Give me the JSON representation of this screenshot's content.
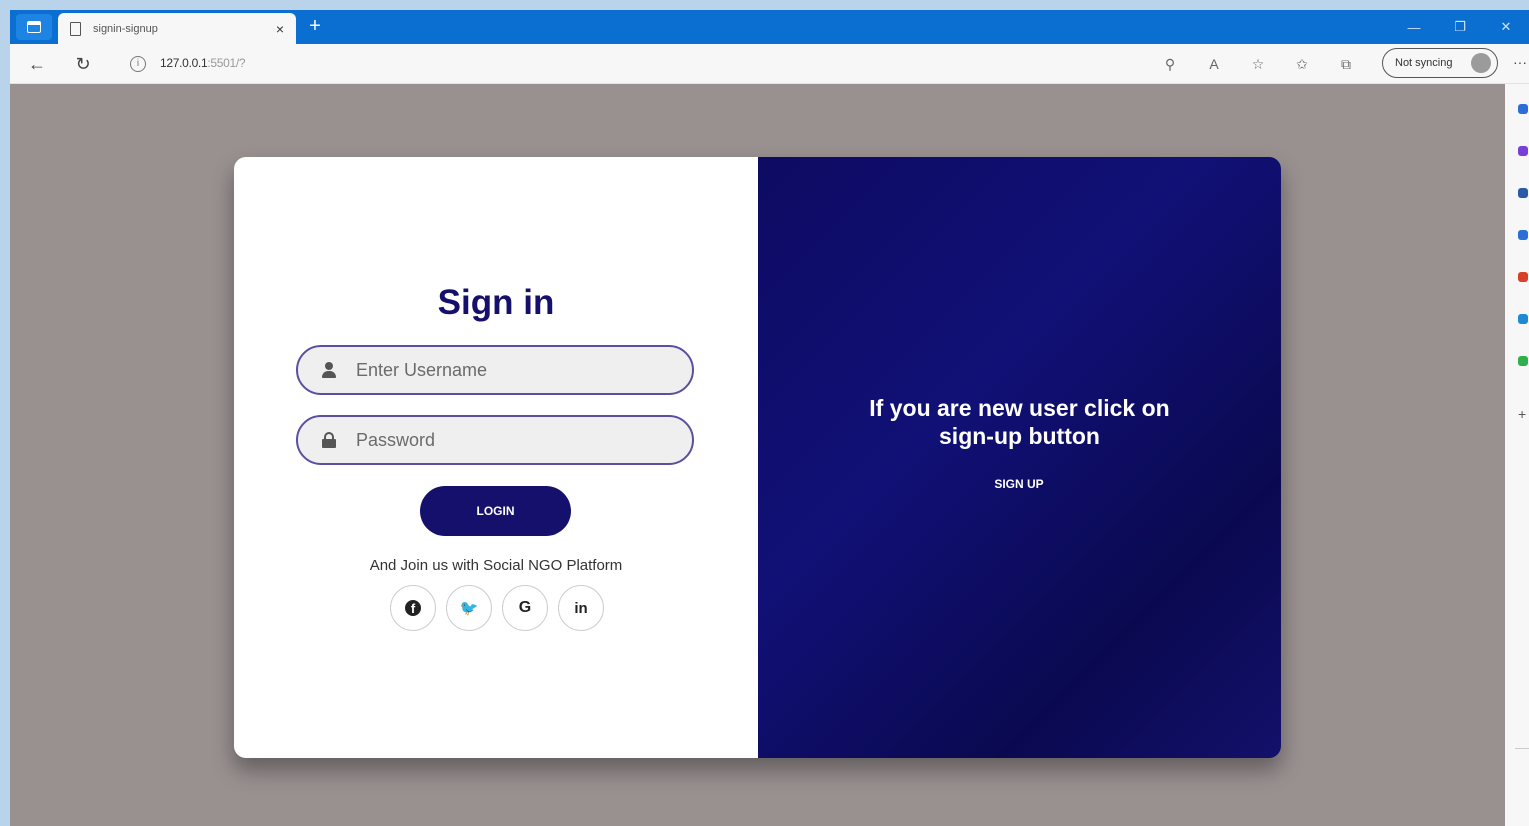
{
  "browser": {
    "tab_title": "signin-signup",
    "tab_close": "×",
    "new_tab": "+",
    "url_host": "127.0.0.1",
    "url_rest": ":5501/?",
    "sync_label": "Not syncing",
    "more": "···"
  },
  "signin": {
    "title": "Sign in",
    "username_placeholder": "Enter Username",
    "password_placeholder": "Password",
    "login_label": "LOGIN",
    "join_text": "And Join us with Social NGO Platform",
    "socials": [
      {
        "name": "facebook",
        "glyph": "f"
      },
      {
        "name": "twitter",
        "glyph": "🐦"
      },
      {
        "name": "google",
        "glyph": "G"
      },
      {
        "name": "linkedin",
        "glyph": "in"
      }
    ]
  },
  "panel": {
    "message_line1": "If you are new user click on",
    "message_line2": "sign-up button",
    "signup_label": "SIGN UP"
  },
  "colors": {
    "brand": "#14106b",
    "panel_bg": "#0d0b62",
    "page_bg": "#999090",
    "titlebar": "#0b6fd1"
  }
}
